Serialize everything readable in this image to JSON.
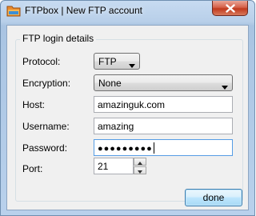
{
  "window": {
    "title": "FTPbox | New FTP account",
    "icon": "ftpbox-app-icon",
    "close_icon": "close-icon"
  },
  "group": {
    "title": "FTP login details"
  },
  "fields": {
    "protocol": {
      "label": "Protocol:",
      "value": "FTP"
    },
    "encryption": {
      "label": "Encryption:",
      "value": "None"
    },
    "host": {
      "label": "Host:",
      "value": "amazinguk.com"
    },
    "username": {
      "label": "Username:",
      "value": "amazing"
    },
    "password": {
      "label": "Password:",
      "masked_value": "●●●●●●●●●"
    },
    "port": {
      "label": "Port:",
      "value": "21"
    }
  },
  "buttons": {
    "done_label": "done"
  },
  "colors": {
    "title_gradient_top": "#c7dbf1",
    "client_bg": "#f0f0f0",
    "focus_border": "#569de5",
    "close_red": "#c0391d"
  }
}
